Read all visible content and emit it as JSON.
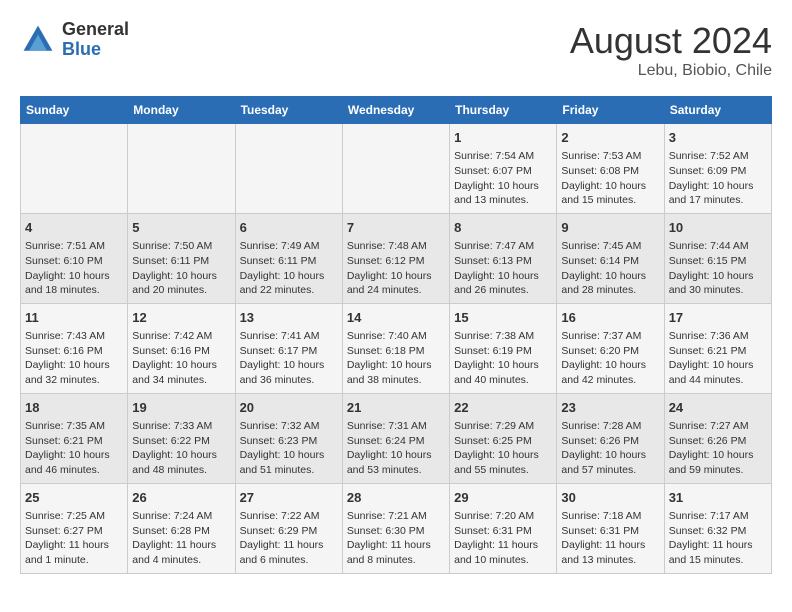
{
  "header": {
    "logo_general": "General",
    "logo_blue": "Blue",
    "title": "August 2024",
    "subtitle": "Lebu, Biobio, Chile"
  },
  "weekdays": [
    "Sunday",
    "Monday",
    "Tuesday",
    "Wednesday",
    "Thursday",
    "Friday",
    "Saturday"
  ],
  "weeks": [
    [
      {
        "day": "",
        "info": ""
      },
      {
        "day": "",
        "info": ""
      },
      {
        "day": "",
        "info": ""
      },
      {
        "day": "",
        "info": ""
      },
      {
        "day": "1",
        "info": "Sunrise: 7:54 AM\nSunset: 6:07 PM\nDaylight: 10 hours\nand 13 minutes."
      },
      {
        "day": "2",
        "info": "Sunrise: 7:53 AM\nSunset: 6:08 PM\nDaylight: 10 hours\nand 15 minutes."
      },
      {
        "day": "3",
        "info": "Sunrise: 7:52 AM\nSunset: 6:09 PM\nDaylight: 10 hours\nand 17 minutes."
      }
    ],
    [
      {
        "day": "4",
        "info": "Sunrise: 7:51 AM\nSunset: 6:10 PM\nDaylight: 10 hours\nand 18 minutes."
      },
      {
        "day": "5",
        "info": "Sunrise: 7:50 AM\nSunset: 6:11 PM\nDaylight: 10 hours\nand 20 minutes."
      },
      {
        "day": "6",
        "info": "Sunrise: 7:49 AM\nSunset: 6:11 PM\nDaylight: 10 hours\nand 22 minutes."
      },
      {
        "day": "7",
        "info": "Sunrise: 7:48 AM\nSunset: 6:12 PM\nDaylight: 10 hours\nand 24 minutes."
      },
      {
        "day": "8",
        "info": "Sunrise: 7:47 AM\nSunset: 6:13 PM\nDaylight: 10 hours\nand 26 minutes."
      },
      {
        "day": "9",
        "info": "Sunrise: 7:45 AM\nSunset: 6:14 PM\nDaylight: 10 hours\nand 28 minutes."
      },
      {
        "day": "10",
        "info": "Sunrise: 7:44 AM\nSunset: 6:15 PM\nDaylight: 10 hours\nand 30 minutes."
      }
    ],
    [
      {
        "day": "11",
        "info": "Sunrise: 7:43 AM\nSunset: 6:16 PM\nDaylight: 10 hours\nand 32 minutes."
      },
      {
        "day": "12",
        "info": "Sunrise: 7:42 AM\nSunset: 6:16 PM\nDaylight: 10 hours\nand 34 minutes."
      },
      {
        "day": "13",
        "info": "Sunrise: 7:41 AM\nSunset: 6:17 PM\nDaylight: 10 hours\nand 36 minutes."
      },
      {
        "day": "14",
        "info": "Sunrise: 7:40 AM\nSunset: 6:18 PM\nDaylight: 10 hours\nand 38 minutes."
      },
      {
        "day": "15",
        "info": "Sunrise: 7:38 AM\nSunset: 6:19 PM\nDaylight: 10 hours\nand 40 minutes."
      },
      {
        "day": "16",
        "info": "Sunrise: 7:37 AM\nSunset: 6:20 PM\nDaylight: 10 hours\nand 42 minutes."
      },
      {
        "day": "17",
        "info": "Sunrise: 7:36 AM\nSunset: 6:21 PM\nDaylight: 10 hours\nand 44 minutes."
      }
    ],
    [
      {
        "day": "18",
        "info": "Sunrise: 7:35 AM\nSunset: 6:21 PM\nDaylight: 10 hours\nand 46 minutes."
      },
      {
        "day": "19",
        "info": "Sunrise: 7:33 AM\nSunset: 6:22 PM\nDaylight: 10 hours\nand 48 minutes."
      },
      {
        "day": "20",
        "info": "Sunrise: 7:32 AM\nSunset: 6:23 PM\nDaylight: 10 hours\nand 51 minutes."
      },
      {
        "day": "21",
        "info": "Sunrise: 7:31 AM\nSunset: 6:24 PM\nDaylight: 10 hours\nand 53 minutes."
      },
      {
        "day": "22",
        "info": "Sunrise: 7:29 AM\nSunset: 6:25 PM\nDaylight: 10 hours\nand 55 minutes."
      },
      {
        "day": "23",
        "info": "Sunrise: 7:28 AM\nSunset: 6:26 PM\nDaylight: 10 hours\nand 57 minutes."
      },
      {
        "day": "24",
        "info": "Sunrise: 7:27 AM\nSunset: 6:26 PM\nDaylight: 10 hours\nand 59 minutes."
      }
    ],
    [
      {
        "day": "25",
        "info": "Sunrise: 7:25 AM\nSunset: 6:27 PM\nDaylight: 11 hours\nand 1 minute."
      },
      {
        "day": "26",
        "info": "Sunrise: 7:24 AM\nSunset: 6:28 PM\nDaylight: 11 hours\nand 4 minutes."
      },
      {
        "day": "27",
        "info": "Sunrise: 7:22 AM\nSunset: 6:29 PM\nDaylight: 11 hours\nand 6 minutes."
      },
      {
        "day": "28",
        "info": "Sunrise: 7:21 AM\nSunset: 6:30 PM\nDaylight: 11 hours\nand 8 minutes."
      },
      {
        "day": "29",
        "info": "Sunrise: 7:20 AM\nSunset: 6:31 PM\nDaylight: 11 hours\nand 10 minutes."
      },
      {
        "day": "30",
        "info": "Sunrise: 7:18 AM\nSunset: 6:31 PM\nDaylight: 11 hours\nand 13 minutes."
      },
      {
        "day": "31",
        "info": "Sunrise: 7:17 AM\nSunset: 6:32 PM\nDaylight: 11 hours\nand 15 minutes."
      }
    ]
  ]
}
